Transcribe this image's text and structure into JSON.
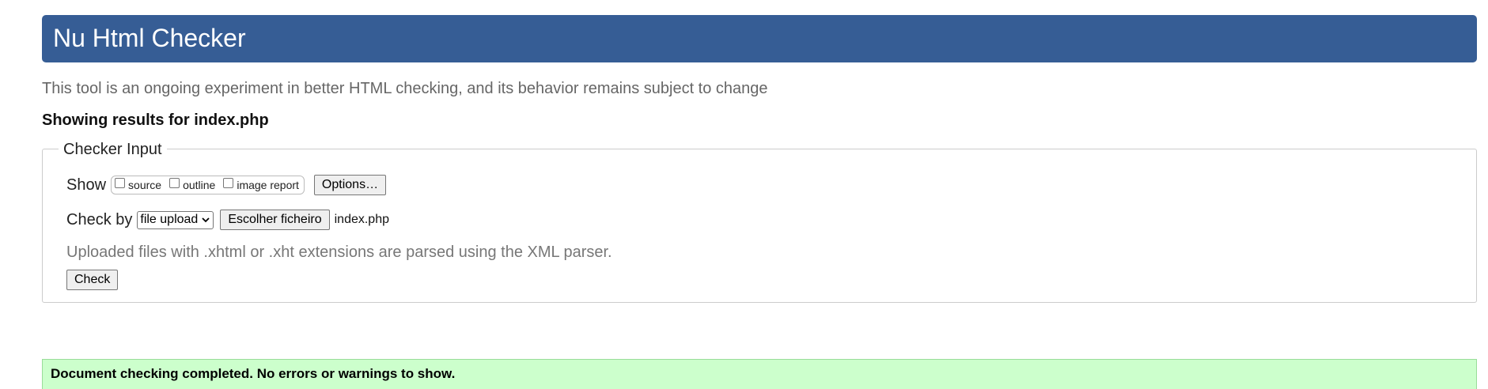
{
  "header": {
    "title": "Nu Html Checker"
  },
  "tagline": "This tool is an ongoing experiment in better HTML checking, and its behavior remains subject to change",
  "results_heading": "Showing results for index.php",
  "checker_input": {
    "legend": "Checker Input",
    "show_label": "Show",
    "toggles": [
      {
        "label": "source",
        "checked": false
      },
      {
        "label": "outline",
        "checked": false
      },
      {
        "label": "image report",
        "checked": false
      }
    ],
    "options_button": "Options…",
    "check_by_label": "Check by",
    "check_by_value": "file upload",
    "choose_file_button": "Escolher ficheiro",
    "file_name": "index.php",
    "note": "Uploaded files with .xhtml or .xht extensions are parsed using the XML parser.",
    "check_button": "Check"
  },
  "status_message": "Document checking completed. No errors or warnings to show.",
  "colors": {
    "banner": "#365d95",
    "success_background": "#ccffcc"
  }
}
